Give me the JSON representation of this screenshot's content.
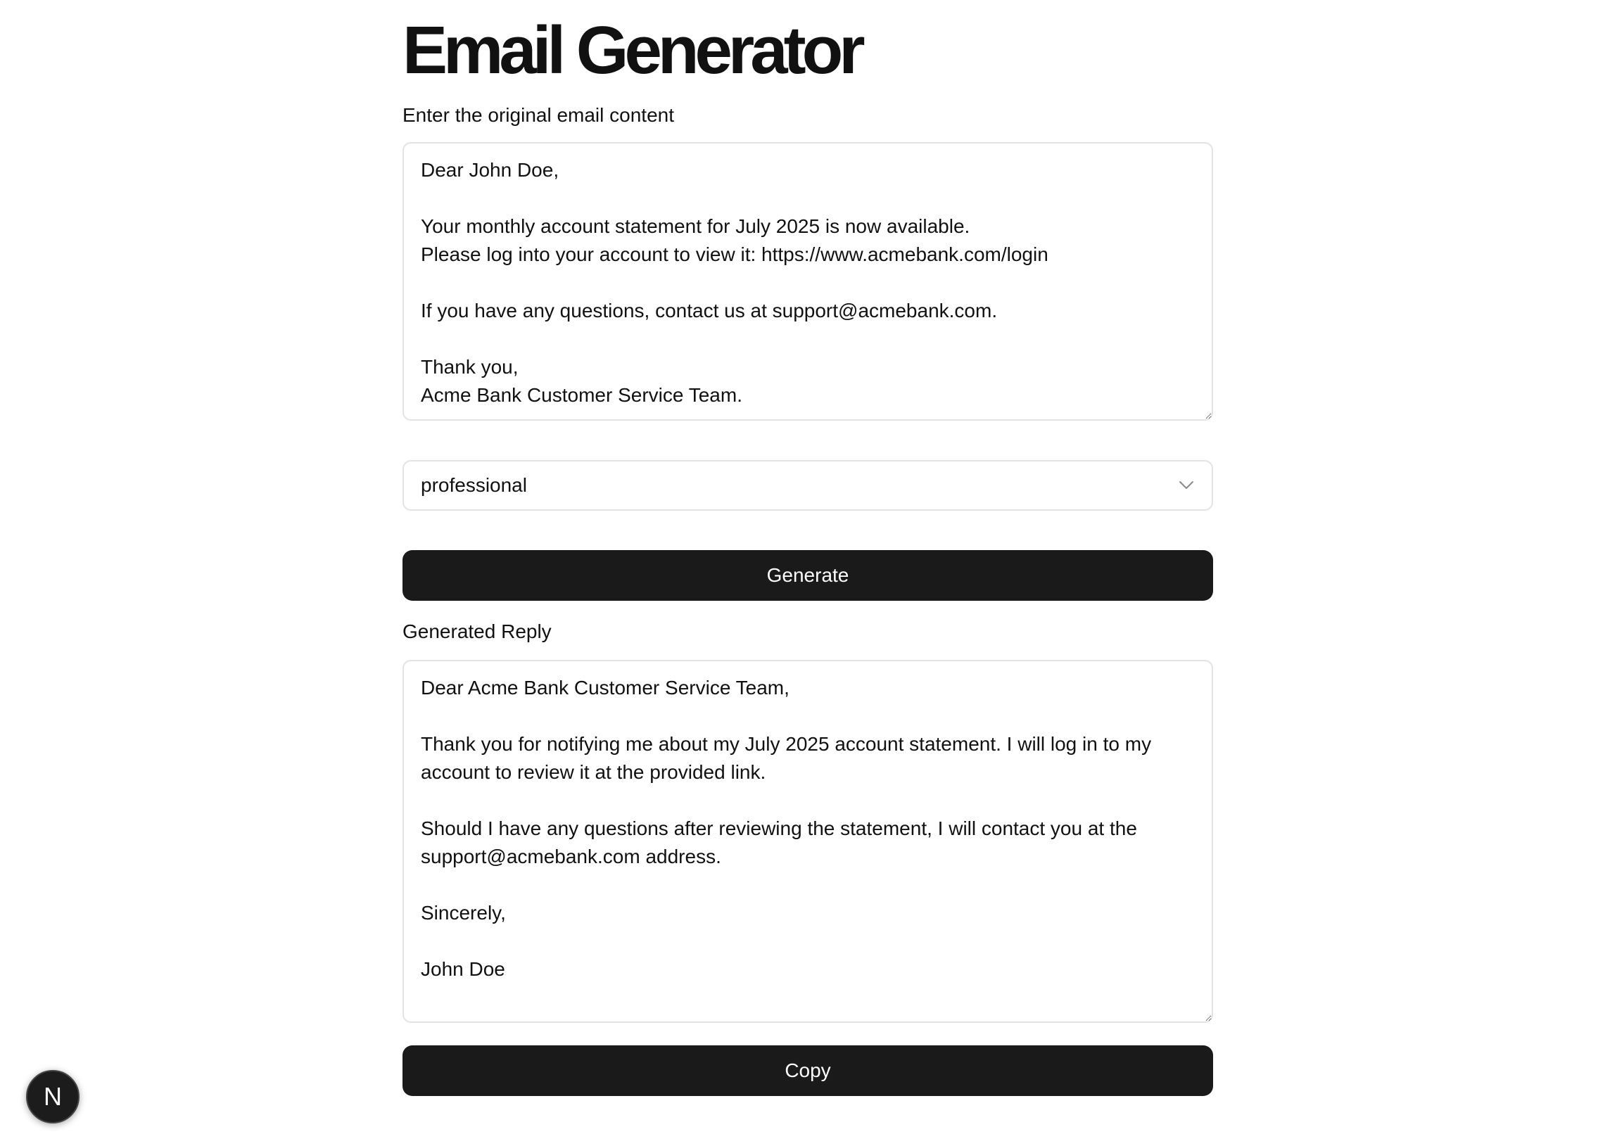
{
  "app": {
    "title": "Email Generator"
  },
  "original": {
    "label": "Enter the original email content",
    "value": "Dear John Doe,\n\nYour monthly account statement for July 2025 is now available.\nPlease log into your account to view it: https://www.acmebank.com/login\n\nIf you have any questions, contact us at support@acmebank.com.\n\nThank you,\nAcme Bank Customer Service Team."
  },
  "tone": {
    "selected": "professional"
  },
  "actions": {
    "generate_label": "Generate",
    "copy_label": "Copy"
  },
  "reply": {
    "label": "Generated Reply",
    "value": "Dear Acme Bank Customer Service Team,\n\nThank you for notifying me about my July 2025 account statement. I will log in to my account to review it at the provided link.\n\nShould I have any questions after reviewing the statement, I will contact you at the support@acmebank.com address.\n\nSincerely,\n\nJohn Doe"
  },
  "badge": {
    "letter": "N",
    "icon": "nextjs-icon"
  },
  "colors": {
    "button": "#1a1a1a",
    "border": "#e3e3e3",
    "text": "#111111"
  }
}
